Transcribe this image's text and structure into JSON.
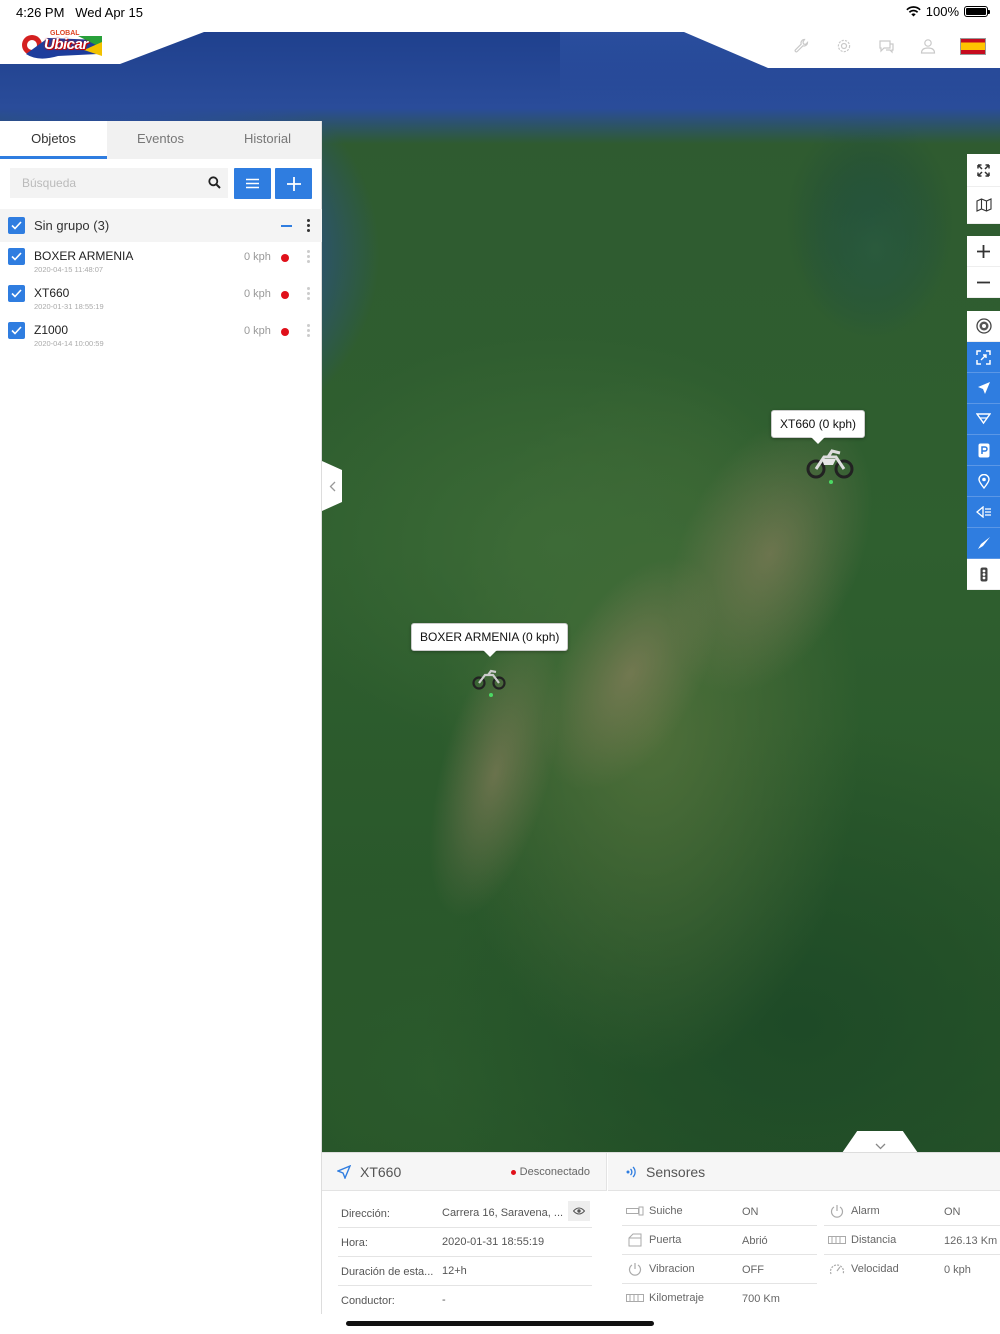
{
  "status_bar": {
    "time": "4:26 PM",
    "date": "Wed Apr 15",
    "battery": "100%",
    "wifi_icon": "wifi-icon",
    "battery_icon": "battery-icon"
  },
  "header": {
    "logo_small": "GLOBAL",
    "logo_text": "Ubicar",
    "icons": [
      "wrench-icon",
      "gear-icon",
      "chat-icon",
      "user-icon",
      "spain-flag-icon"
    ]
  },
  "tabs": [
    {
      "label": "Objetos",
      "active": true
    },
    {
      "label": "Eventos",
      "active": false
    },
    {
      "label": "Historial",
      "active": false
    }
  ],
  "search": {
    "placeholder": "Búsqueda"
  },
  "group": {
    "label": "Sin grupo (3)"
  },
  "devices": [
    {
      "name": "BOXER ARMENIA",
      "time": "2020-04-15 11:48:07",
      "speed": "0 kph",
      "status_color": "#e0101a"
    },
    {
      "name": "XT660",
      "time": "2020-01-31 18:55:19",
      "speed": "0 kph",
      "status_color": "#e0101a"
    },
    {
      "name": "Z1000",
      "time": "2020-04-14 10:00:59",
      "speed": "0 kph",
      "status_color": "#e0101a"
    }
  ],
  "map": {
    "markers": [
      {
        "label": "XT660 (0 kph)"
      },
      {
        "label": "BOXER ARMENIA (0 kph)"
      }
    ],
    "toolbar_icons": [
      "fullscreen-icon",
      "map-layers-icon",
      "zoom-in-icon",
      "zoom-out-icon",
      "radar-icon",
      "fit-bounds-icon",
      "navigate-icon",
      "route-icon",
      "parking-icon",
      "poi-icon",
      "geofence-icon",
      "send-command-icon",
      "traffic-icon"
    ]
  },
  "info_panel": {
    "device": "XT660",
    "status": "Desconectado",
    "rows": [
      {
        "key": "Dirección:",
        "value": "Carrera 16, Saravena, ..."
      },
      {
        "key": "Hora:",
        "value": "2020-01-31 18:55:19"
      },
      {
        "key": "Duración de esta...",
        "value": "12+h"
      },
      {
        "key": "Conductor:",
        "value": "-"
      }
    ]
  },
  "sensors": {
    "title": "Sensores",
    "col1": [
      {
        "name": "Suiche",
        "value": "ON",
        "icon": "ignition-icon"
      },
      {
        "name": "Puerta",
        "value": "Abrió",
        "icon": "door-icon"
      },
      {
        "name": "Vibracion",
        "value": "OFF",
        "icon": "power-icon"
      },
      {
        "name": "Kilometraje",
        "value": "700 Km",
        "icon": "odometer-icon"
      }
    ],
    "col2": [
      {
        "name": "Alarm",
        "value": "ON",
        "icon": "power-icon"
      },
      {
        "name": "Distancia",
        "value": "126.13 Km",
        "icon": "odometer-icon"
      },
      {
        "name": "Velocidad",
        "value": "0 kph",
        "icon": "speedometer-icon"
      }
    ]
  },
  "colors": {
    "accent": "#2f7de0",
    "offline": "#e0101a"
  }
}
